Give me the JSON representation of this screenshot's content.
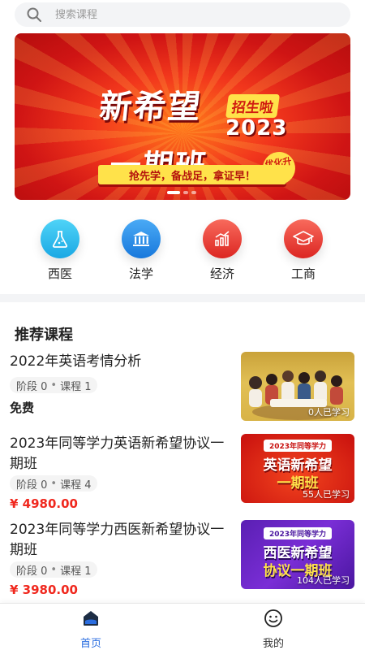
{
  "search": {
    "placeholder": "搜索课程"
  },
  "banner": {
    "title_line1": "新希望",
    "tag": "招生啦",
    "year": "2023",
    "title_line2": "一期班",
    "badge": "优化升级",
    "slogan": "抢先学，备战足，拿证早！"
  },
  "categories": [
    {
      "label": "西医",
      "icon": "flask-icon",
      "color": "#26b8ec"
    },
    {
      "label": "法学",
      "icon": "courthouse-icon",
      "color": "#1f8fe6"
    },
    {
      "label": "经济",
      "icon": "chart-icon",
      "color": "#ea3a33"
    },
    {
      "label": "工商",
      "icon": "graduation-cap-icon",
      "color": "#ea3a33"
    }
  ],
  "section": {
    "title": "推荐课程"
  },
  "courses": [
    {
      "title": "2022年英语考情分析",
      "stage": "阶段 0",
      "lessons": "课程 1",
      "price": "免费",
      "learners": "0人已学习"
    },
    {
      "title": "2023年同等学力英语新希望协议一期班",
      "stage": "阶段 0",
      "lessons": "课程 4",
      "price": "¥ 4980.00",
      "learners": "55人已学习",
      "thumb_tag": "2023年同等学力",
      "thumb_line1": "英语新希望",
      "thumb_line2": "一期班"
    },
    {
      "title": "2023年同等学力西医新希望协议一期班",
      "stage": "阶段 0",
      "lessons": "课程 1",
      "price": "¥ 3980.00",
      "learners": "104人已学习",
      "thumb_tag": "2023年同等学力",
      "thumb_line1": "西医新希望",
      "thumb_line2": "协议一期班"
    }
  ],
  "tabbar": {
    "home": "首页",
    "mine": "我的"
  },
  "colors": {
    "accent": "#2a6de0",
    "price": "#f0281e"
  }
}
